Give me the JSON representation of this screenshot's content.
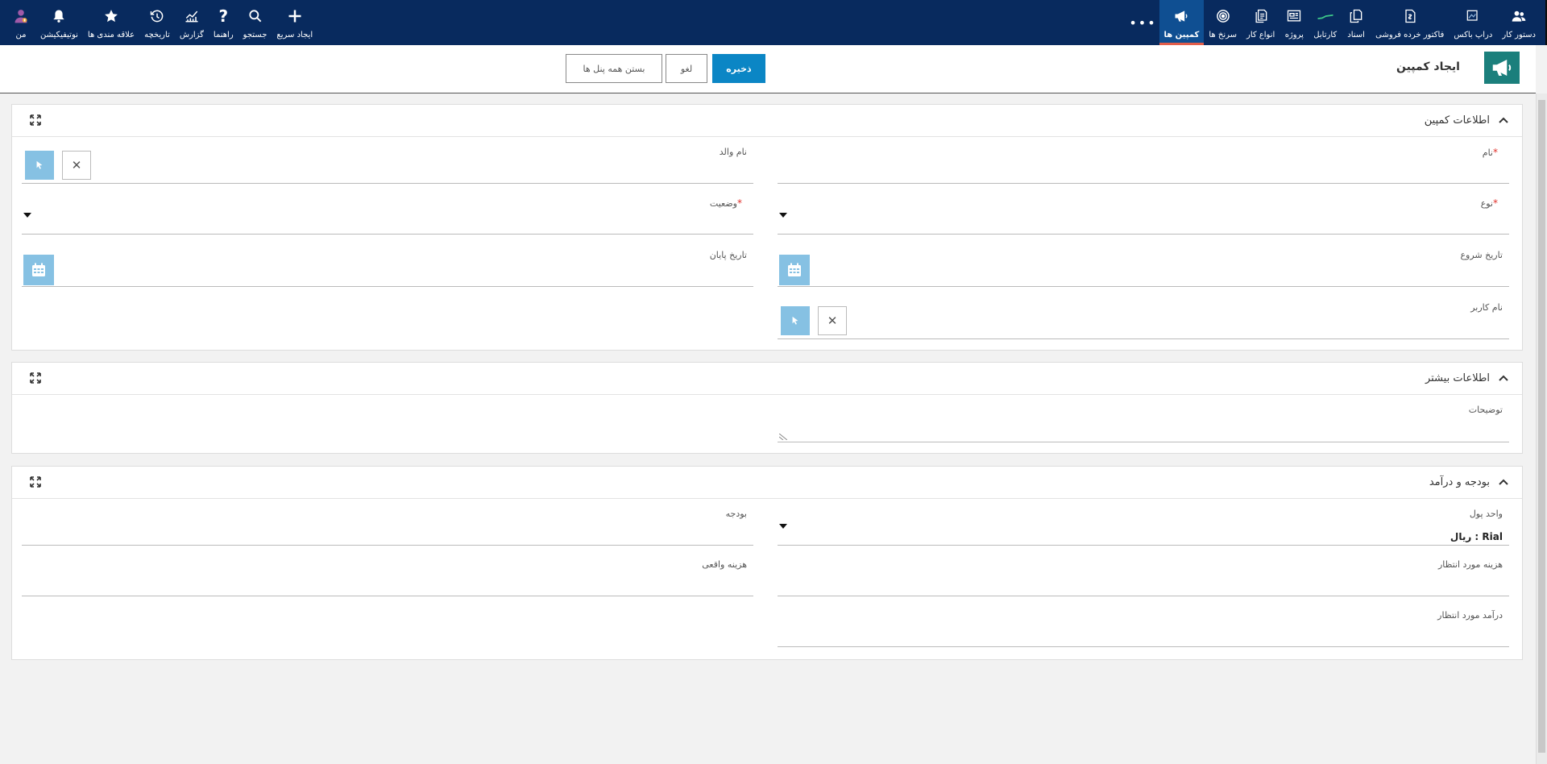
{
  "topnav": {
    "right_items": [
      {
        "label": "دستور کار",
        "icon": "users-icon"
      },
      {
        "label": "دراپ باکس",
        "icon": "dropbox-image-icon"
      },
      {
        "label": "فاکتور خرده فروشی",
        "icon": "invoice-icon"
      },
      {
        "label": "اسناد",
        "icon": "documents-icon"
      },
      {
        "label": "کارتابل",
        "icon": "kartable-icon"
      },
      {
        "label": "پروژه",
        "icon": "project-icon"
      },
      {
        "label": "انواع کار",
        "icon": "task-types-icon"
      },
      {
        "label": "سرنخ ها",
        "icon": "target-icon"
      },
      {
        "label": "کمپین ها",
        "icon": "megaphone-icon",
        "active": true
      }
    ],
    "more_label": "•••",
    "left_items": [
      {
        "label": "من",
        "icon": "user-avatar-icon"
      },
      {
        "label": "نوتیفیکیشن",
        "icon": "bell-icon"
      },
      {
        "label": "علاقه مندی ها",
        "icon": "star-icon"
      },
      {
        "label": "تاریخچه",
        "icon": "history-icon"
      },
      {
        "label": "گزارش",
        "icon": "report-chart-icon"
      },
      {
        "label": "راهنما",
        "icon": "question-icon"
      },
      {
        "label": "جستجو",
        "icon": "search-icon"
      },
      {
        "label": "ایجاد سریع",
        "icon": "plus-icon"
      }
    ]
  },
  "header": {
    "title": "ایجاد کمپین",
    "save_label": "ذخیره",
    "cancel_label": "لغو",
    "close_all_label": "بستن همه پنل ها"
  },
  "panels": {
    "info": {
      "title": "اطلاعات کمپین",
      "name_label": "نام",
      "parent_name_label": "نام والد",
      "type_label": "نوع",
      "status_label": "وضعیت",
      "start_date_label": "تاریخ شروع",
      "end_date_label": "تاریخ پایان",
      "username_label": "نام کاربر",
      "required_mark": "*"
    },
    "more": {
      "title": "اطلاعات بیشتر",
      "description_label": "توضیحات"
    },
    "budget": {
      "title": "بودجه و درآمد",
      "currency_label": "واحد پول",
      "currency_value": "Rial : ریال",
      "budget_label": "بودجه",
      "expected_cost_label": "هزینه مورد انتظار",
      "actual_cost_label": "هزینه واقعی",
      "expected_revenue_label": "درآمد مورد انتظار"
    }
  },
  "colors": {
    "navbar": "#082a5e",
    "active_tab": "#0f4f92",
    "active_underline": "#e25d4a",
    "primary_button": "#0b86c5",
    "light_blue_button": "#86c1e3",
    "page_icon_bg": "#1b7f7c",
    "required": "#e0302a"
  }
}
